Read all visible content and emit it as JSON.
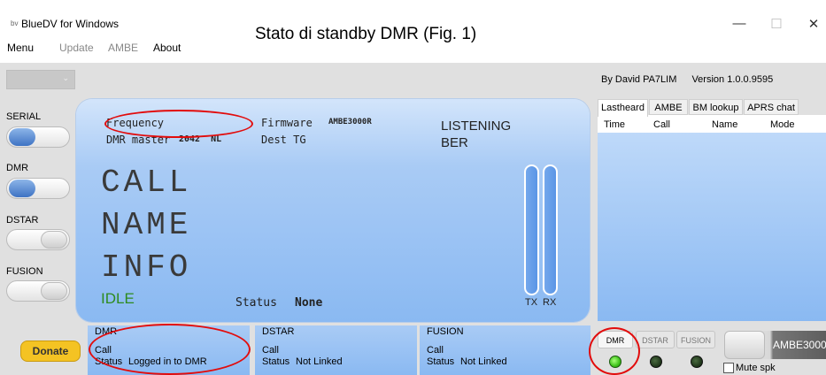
{
  "window": {
    "title": "BlueDV for Windows",
    "app_icon": "bluedv-app-icon",
    "overlay_title": "Stato di standby DMR (Fig. 1)",
    "controls": {
      "minimize": "—",
      "maximize": "☐",
      "close": "✕"
    }
  },
  "menu": [
    "Menu",
    "Update",
    "AMBE",
    "About"
  ],
  "sidebar": {
    "combo_value": "",
    "items": [
      {
        "label": "SERIAL",
        "state": "on"
      },
      {
        "label": "DMR",
        "state": "on"
      },
      {
        "label": "DSTAR",
        "state": "off"
      },
      {
        "label": "FUSION",
        "state": "off"
      }
    ]
  },
  "display": {
    "frequency_label": "Frequency",
    "firmware_label": "Firmware",
    "firmware_value": "AMBE3000R",
    "listening": "LISTENING",
    "dmr_master_label": "DMR master",
    "dmr_master_value": "2042  NL",
    "dest_tg_label": "Dest TG",
    "ber_label": "BER",
    "call": "CALL",
    "name": "NAME",
    "info": "INFO",
    "idle": "IDLE",
    "status_label": "Status",
    "status_value": "None",
    "tx": "TX",
    "rx": "RX"
  },
  "donate": "Donate",
  "bottom_panels": [
    {
      "title": "DMR",
      "call_label": "Call",
      "status_label": "Status",
      "status_value": "Logged in to DMR"
    },
    {
      "title": "DSTAR",
      "call_label": "Call",
      "status_label": "Status",
      "status_value": "Not Linked"
    },
    {
      "title": "FUSION",
      "call_label": "Call",
      "status_label": "Status",
      "status_value": "Not Linked"
    }
  ],
  "right": {
    "author": "By David PA7LIM",
    "version": "Version 1.0.0.9595",
    "tabs": [
      "Lastheard",
      "AMBE",
      "BM lookup",
      "APRS chat"
    ],
    "columns": [
      "Time",
      "Call",
      "Name",
      "Mode"
    ],
    "mode_buttons": [
      "DMR",
      "DSTAR",
      "FUSION"
    ],
    "leds": [
      {
        "name": "dmr-led",
        "color": "#3ec21a"
      },
      {
        "name": "dstar-led",
        "color": "#1d3318"
      },
      {
        "name": "fusion-led",
        "color": "#1d3318"
      }
    ],
    "ambe_label": "AMBE3000",
    "mute_label": "Mute spk"
  },
  "colors": {
    "panel_blue": "#8ab9f2",
    "idle_green": "#2e8b1e",
    "annotation_red": "#e20c0c",
    "donate_yellow": "#f4c323"
  }
}
